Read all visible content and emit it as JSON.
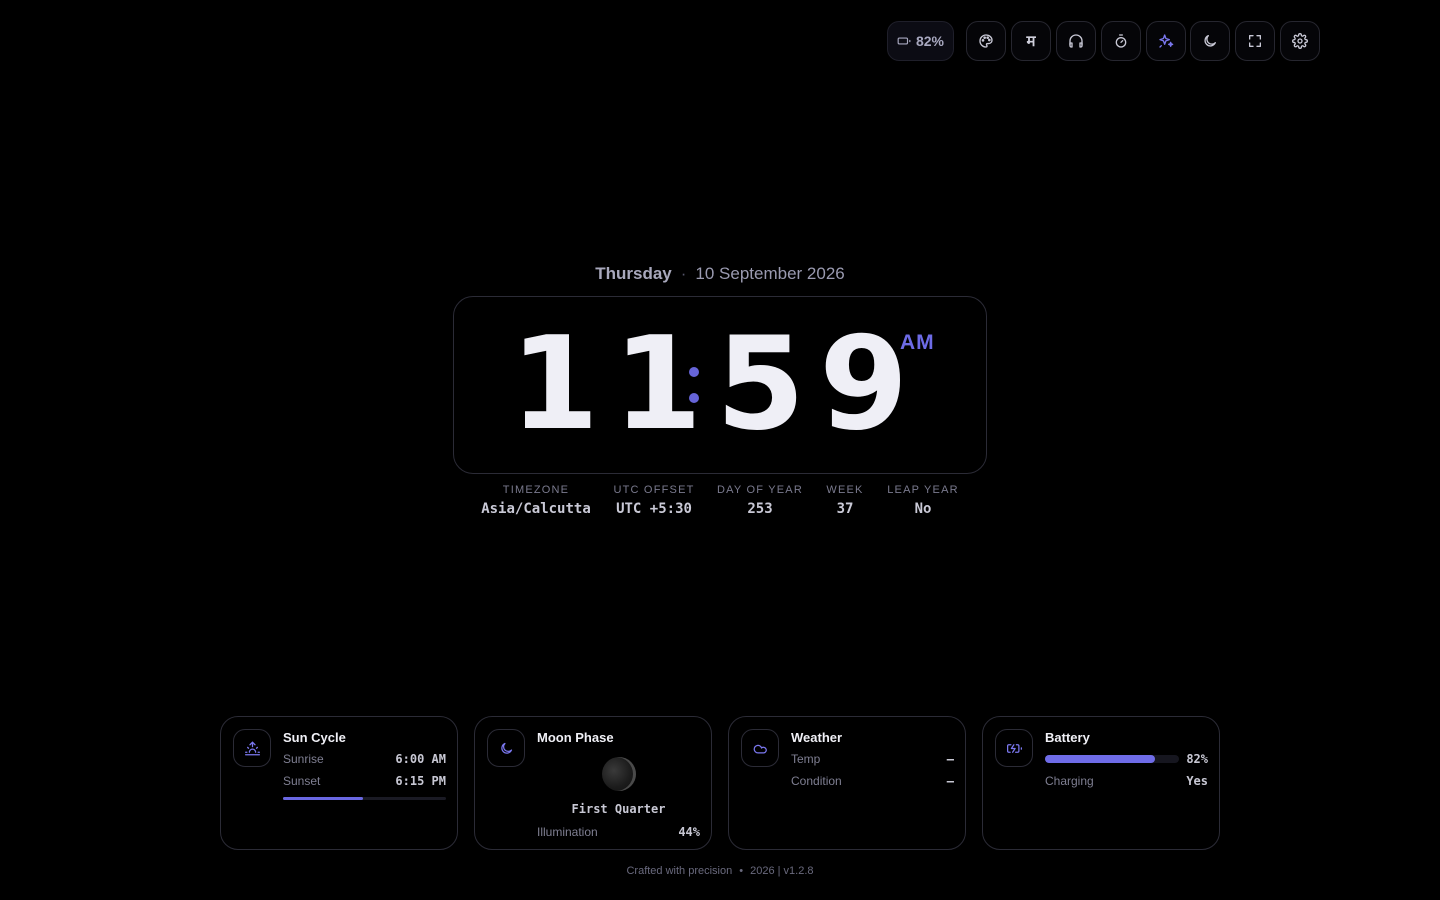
{
  "toolbar": {
    "battery_level": "82%",
    "buttons": [
      {
        "name": "theme",
        "icon": "palette-icon"
      },
      {
        "name": "language",
        "icon": "devanagari-glyph",
        "glyph": "म"
      },
      {
        "name": "audio",
        "icon": "headphones-icon"
      },
      {
        "name": "timer",
        "icon": "stopwatch-icon"
      },
      {
        "name": "effects",
        "icon": "sparkles-icon",
        "active": true
      },
      {
        "name": "dark-mode",
        "icon": "moon-icon"
      },
      {
        "name": "fullscreen",
        "icon": "fullscreen-icon"
      },
      {
        "name": "settings",
        "icon": "gear-icon"
      }
    ]
  },
  "date": {
    "weekday": "Thursday",
    "separator": "·",
    "full_date": "10 September 2026"
  },
  "clock": {
    "hours": "11",
    "minutes": "59",
    "period": "AM"
  },
  "info": {
    "timezone_label": "Timezone",
    "timezone_value": "Asia/Calcutta",
    "utc_label": "UTC Offset",
    "utc_value": "UTC +5:30",
    "doy_label": "Day of Year",
    "doy_value": "253",
    "week_label": "Week",
    "week_value": "37",
    "leap_label": "Leap Year",
    "leap_value": "No"
  },
  "cards": {
    "sun": {
      "title": "Sun Cycle",
      "sunrise_label": "Sunrise",
      "sunrise_value": "6:00 AM",
      "sunset_label": "Sunset",
      "sunset_value": "6:15 PM",
      "day_progress": 0.49
    },
    "moon": {
      "title": "Moon Phase",
      "phase": "First Quarter",
      "illumination_label": "Illumination",
      "illumination_value": "44%"
    },
    "weather": {
      "title": "Weather",
      "temp_label": "Temp",
      "temp_value": "—",
      "condition_label": "Condition",
      "condition_value": "—"
    },
    "battery": {
      "title": "Battery",
      "level_value": "82%",
      "level": 0.82,
      "charging_label": "Charging",
      "charging_value": "Yes"
    }
  },
  "footer": {
    "tagline": "Crafted with precision",
    "dot": "•",
    "version": "2026 | v1.2.8"
  },
  "colors": {
    "accent": "#6d6be6",
    "background": "#000000",
    "text": "#efeff6",
    "muted": "#7a7a8e"
  }
}
